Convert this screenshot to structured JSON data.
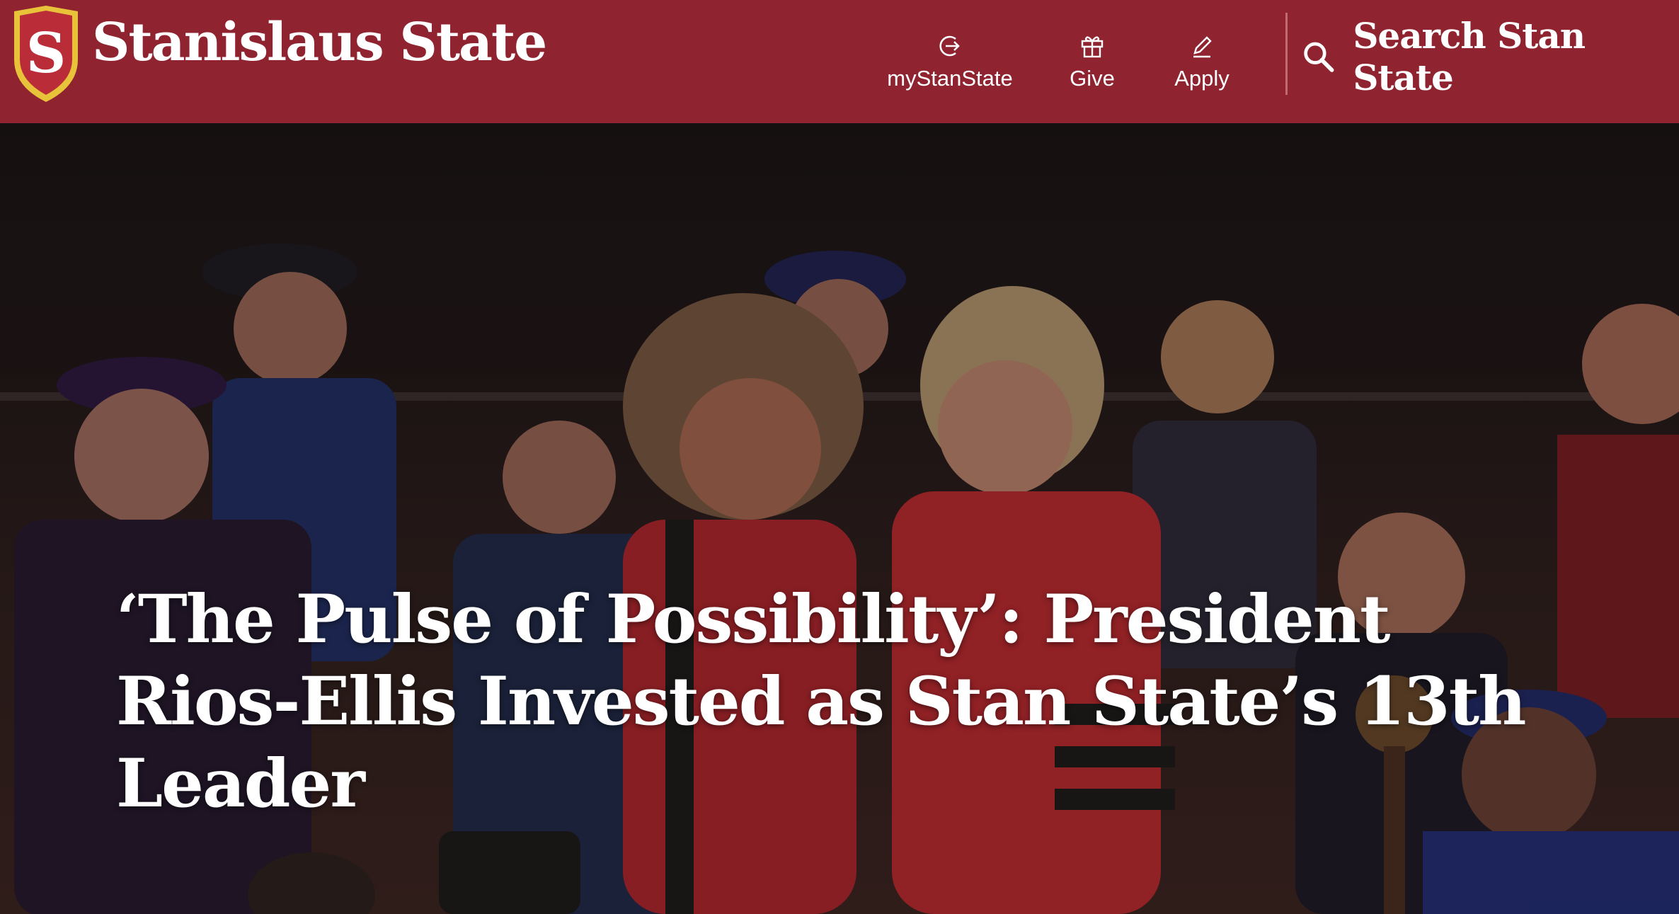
{
  "header": {
    "brand": "Stanislaus State",
    "logo_letter": "S",
    "utility_nav": [
      {
        "label": "myStanState",
        "icon": "login-icon"
      },
      {
        "label": "Give",
        "icon": "gift-icon"
      },
      {
        "label": "Apply",
        "icon": "pencil-icon"
      }
    ],
    "search_label": "Search Stan State",
    "search_icon": "search-icon"
  },
  "hero": {
    "headline": "‘The Pulse of Possibility’: President Rios-Ellis Invested as Stan State’s 13th Leader",
    "image_alt": "Commencement stage with faculty in academic regalia as President Rios-Ellis is embraced"
  },
  "colors": {
    "brand_red": "#8f2430",
    "logo_gold": "#e8c33a",
    "text_white": "#ffffff"
  }
}
